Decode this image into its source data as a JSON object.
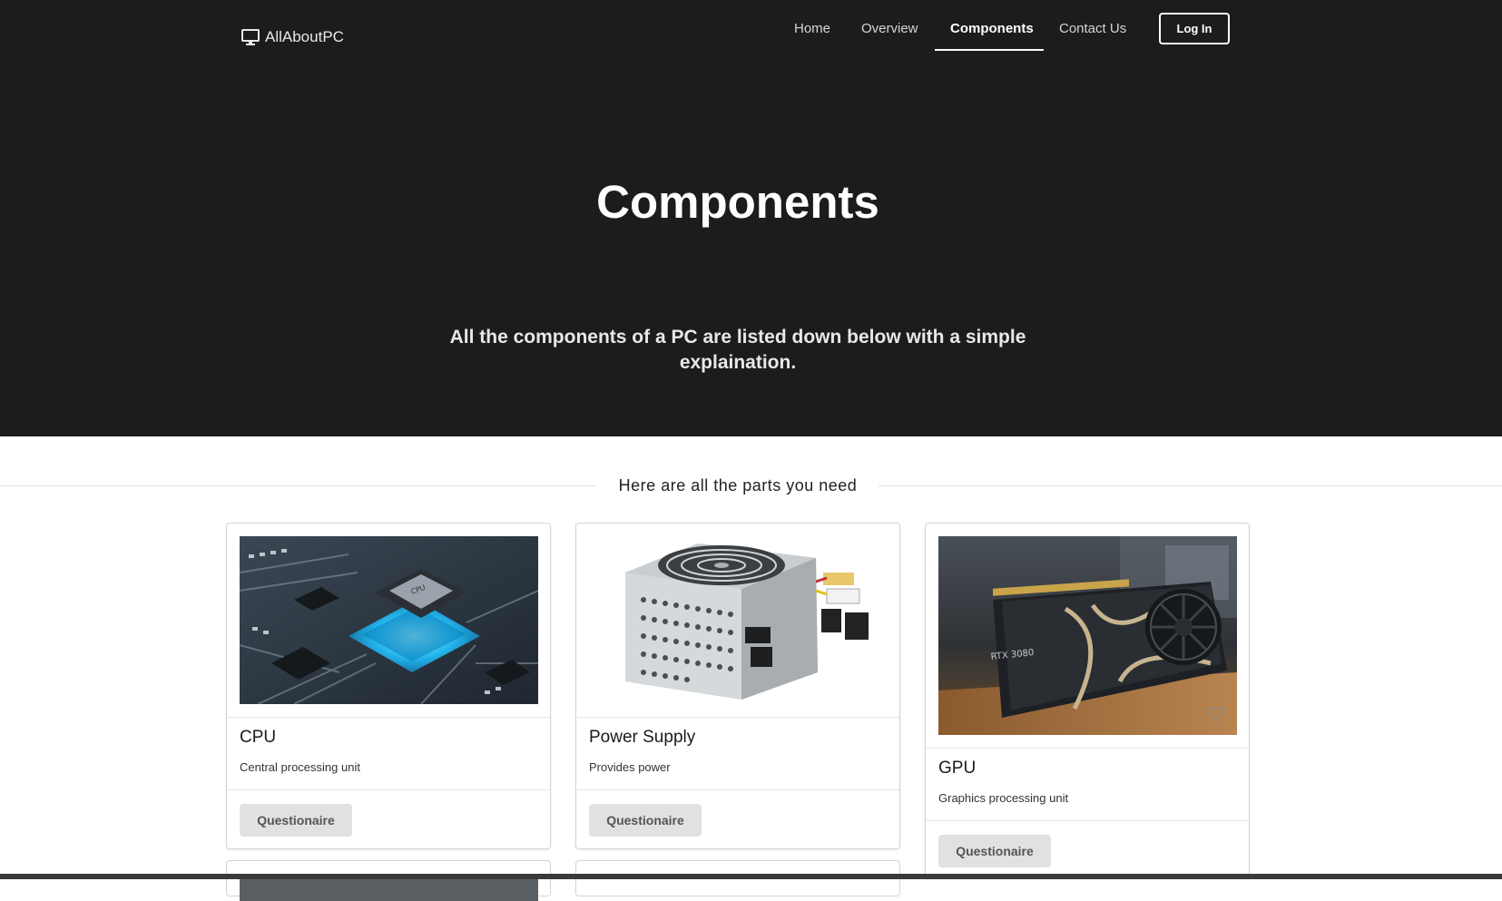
{
  "brand": {
    "name": "AllAboutPC",
    "icon": "monitor-icon"
  },
  "nav": {
    "items": [
      {
        "label": "Home",
        "active": false
      },
      {
        "label": "Overview",
        "active": false
      },
      {
        "label": "Components",
        "active": true
      },
      {
        "label": "Contact Us",
        "active": false
      }
    ],
    "login_label": "Log In"
  },
  "hero": {
    "title": "Components",
    "subtitle": "All the components of a PC are listed down below with a simple explaination."
  },
  "section": {
    "heading": "Here are all the parts you need"
  },
  "cards": [
    {
      "title": "CPU",
      "description": "Central processing unit",
      "button": "Questionaire",
      "image": "cpu-image"
    },
    {
      "title": "Power Supply",
      "description": "Provides power",
      "button": "Questionaire",
      "image": "power-supply-image"
    },
    {
      "title": "GPU",
      "description": "Graphics processing unit",
      "button": "Questionaire",
      "image": "gpu-image",
      "image_label": "RTX 3080"
    }
  ],
  "colors": {
    "hero_background": "#1b1c1d",
    "button_background": "#e0e1e2",
    "card_border": "#d4d4d5"
  }
}
